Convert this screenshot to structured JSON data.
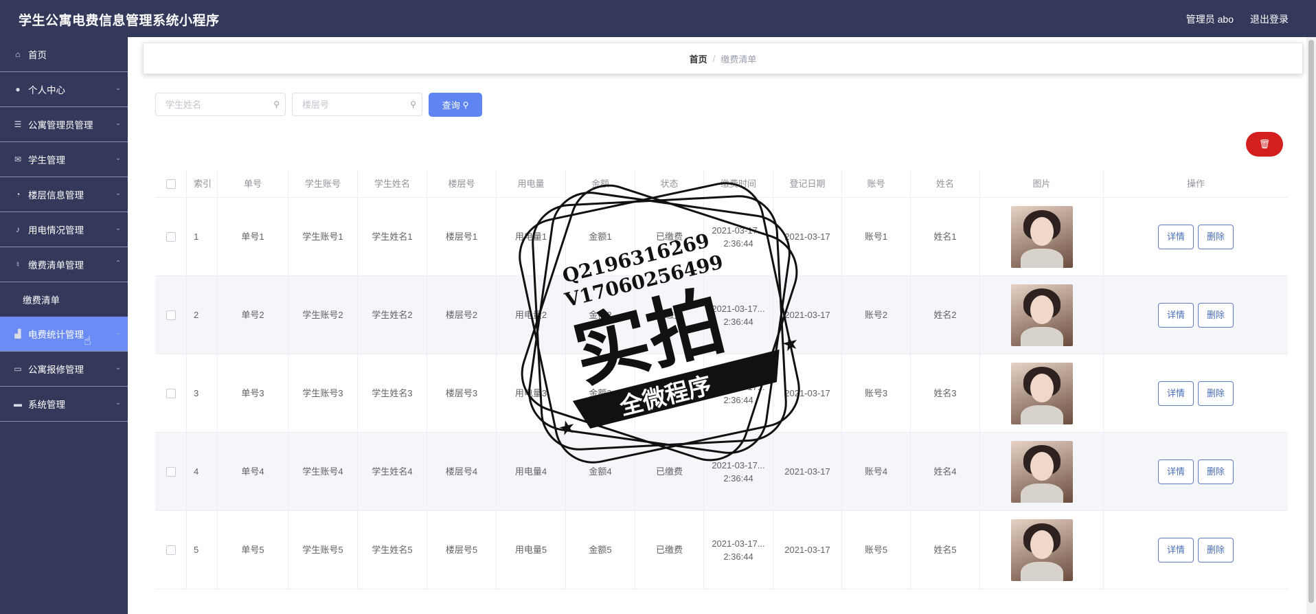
{
  "header": {
    "title": "学生公寓电费信息管理系统小程序",
    "admin_label": "管理员 abo",
    "logout_label": "退出登录"
  },
  "sidebar": {
    "items": [
      {
        "label": "首页",
        "icon": "home-icon",
        "chevron": false,
        "active": false
      },
      {
        "label": "个人中心",
        "icon": "user-icon",
        "chevron": true,
        "active": false
      },
      {
        "label": "公寓管理员管理",
        "icon": "list-icon",
        "chevron": true,
        "active": false
      },
      {
        "label": "学生管理",
        "icon": "mail-icon",
        "chevron": true,
        "active": false
      },
      {
        "label": "楼层信息管理",
        "icon": "gauge-icon",
        "chevron": true,
        "active": false
      },
      {
        "label": "用电情况管理",
        "icon": "bell-icon",
        "chevron": true,
        "active": false
      },
      {
        "label": "缴费清单管理",
        "icon": "mic-icon",
        "chevron": true,
        "active": false,
        "expanded": true
      },
      {
        "label": "缴费清单",
        "sub": true
      },
      {
        "label": "电费统计管理",
        "icon": "chart-icon",
        "chevron": true,
        "active": true
      },
      {
        "label": "公寓报修管理",
        "icon": "chat-icon",
        "chevron": true,
        "active": false
      },
      {
        "label": "系统管理",
        "icon": "monitor-icon",
        "chevron": true,
        "active": false
      }
    ]
  },
  "breadcrumb": {
    "home": "首页",
    "separator": "/",
    "current": "缴费清单"
  },
  "search": {
    "student_name_placeholder": "学生姓名",
    "floor_placeholder": "楼层号",
    "query_label": "查询"
  },
  "table": {
    "columns": [
      "索引",
      "单号",
      "学生账号",
      "学生姓名",
      "楼层号",
      "用电量",
      "金额",
      "状态",
      "缴费时间",
      "登记日期",
      "账号",
      "姓名",
      "图片",
      "操作"
    ],
    "rows": [
      {
        "index": "1",
        "order": "单号1",
        "account": "学生账号1",
        "name": "学生姓名1",
        "floor": "楼层号1",
        "usage": "用电量1",
        "amount": "金额1",
        "status": "已缴费",
        "pay_time": "2021-03-17... 2:36:44",
        "reg_date": "2021-03-17",
        "acct": "账号1",
        "person": "姓名1"
      },
      {
        "index": "2",
        "order": "单号2",
        "account": "学生账号2",
        "name": "学生姓名2",
        "floor": "楼层号2",
        "usage": "用电量2",
        "amount": "金额2",
        "status": "已缴费",
        "pay_time": "2021-03-17... 2:36:44",
        "reg_date": "2021-03-17",
        "acct": "账号2",
        "person": "姓名2"
      },
      {
        "index": "3",
        "order": "单号3",
        "account": "学生账号3",
        "name": "学生姓名3",
        "floor": "楼层号3",
        "usage": "用电量3",
        "amount": "金额3",
        "status": "已缴费",
        "pay_time": "2021-03-17... 2:36:44",
        "reg_date": "2021-03-17",
        "acct": "账号3",
        "person": "姓名3"
      },
      {
        "index": "4",
        "order": "单号4",
        "account": "学生账号4",
        "name": "学生姓名4",
        "floor": "楼层号4",
        "usage": "用电量4",
        "amount": "金额4",
        "status": "已缴费",
        "pay_time": "2021-03-17... 2:36:44",
        "reg_date": "2021-03-17",
        "acct": "账号4",
        "person": "姓名4"
      },
      {
        "index": "5",
        "order": "单号5",
        "account": "学生账号5",
        "name": "学生姓名5",
        "floor": "楼层号5",
        "usage": "用电量5",
        "amount": "金额5",
        "status": "已缴费",
        "pay_time": "2021-03-17... 2:36:44",
        "reg_date": "2021-03-17",
        "acct": "账号5",
        "person": "姓名5"
      }
    ],
    "detail_label": "详情",
    "delete_label": "删除"
  },
  "watermark": {
    "line1": "Q2196316269",
    "line2": "V17060256499",
    "big": "实拍",
    "banner": "全微程序"
  },
  "colors": {
    "header_bg": "#34385a",
    "sidebar_bg": "#34385a",
    "active_item": "#6c8cf5",
    "query_button": "#5f85f2",
    "delete_button": "#d3201f"
  }
}
